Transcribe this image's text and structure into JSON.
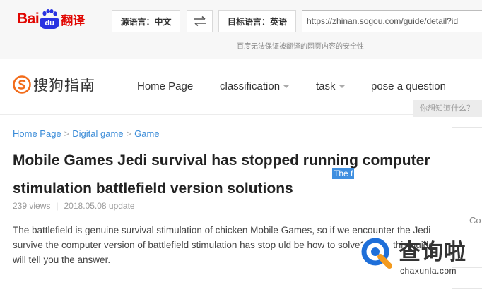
{
  "translate_bar": {
    "logo_text_left": "Bai",
    "logo_text_du": "du",
    "logo_text_right": "翻译",
    "source_lang_label": "源语言：中文",
    "target_lang_label": "目标语言：英语",
    "swap_icon": "swap-arrows-icon",
    "url_value": "https://zhinan.sogou.com/guide/detail?id",
    "note": "百度无法保证被翻译的网页内容的安全性",
    "brand_red": "#e10601",
    "brand_blue": "#2932e1"
  },
  "nav": {
    "logo_text": "搜狗指南",
    "logo_icon": "sogou-s-icon",
    "items": [
      {
        "label": "Home Page",
        "has_caret": false
      },
      {
        "label": "classification",
        "has_caret": true
      },
      {
        "label": "task",
        "has_caret": true
      },
      {
        "label": "pose a question",
        "has_caret": false
      }
    ],
    "search_placeholder": "你想知道什么？",
    "accent": "#f26c1b"
  },
  "breadcrumb": {
    "items": [
      "Home Page",
      "Digital game",
      "Game"
    ],
    "separator": ">"
  },
  "article": {
    "title": "Mobile Games Jedi survival has stopped running computer stimulation battlefield version solutions",
    "highlight_text": "The f",
    "views": "239 views",
    "date": "2018.05.08 update",
    "body": "The battlefield is genuine survival stimulation of chicken Mobile Games, so if we encounter the Jedi survive the computer version of battlefield stimulation has stop uld be how to solve? Next, this guide will tell you the answer."
  },
  "side_panel": {
    "text": "Co"
  },
  "watermark": {
    "chinese": "查询啦",
    "url": "chaxunla.com",
    "icon": "chaxunla-q-icon",
    "colors": {
      "blue": "#1e6fd9",
      "orange": "#f39a1e"
    }
  }
}
